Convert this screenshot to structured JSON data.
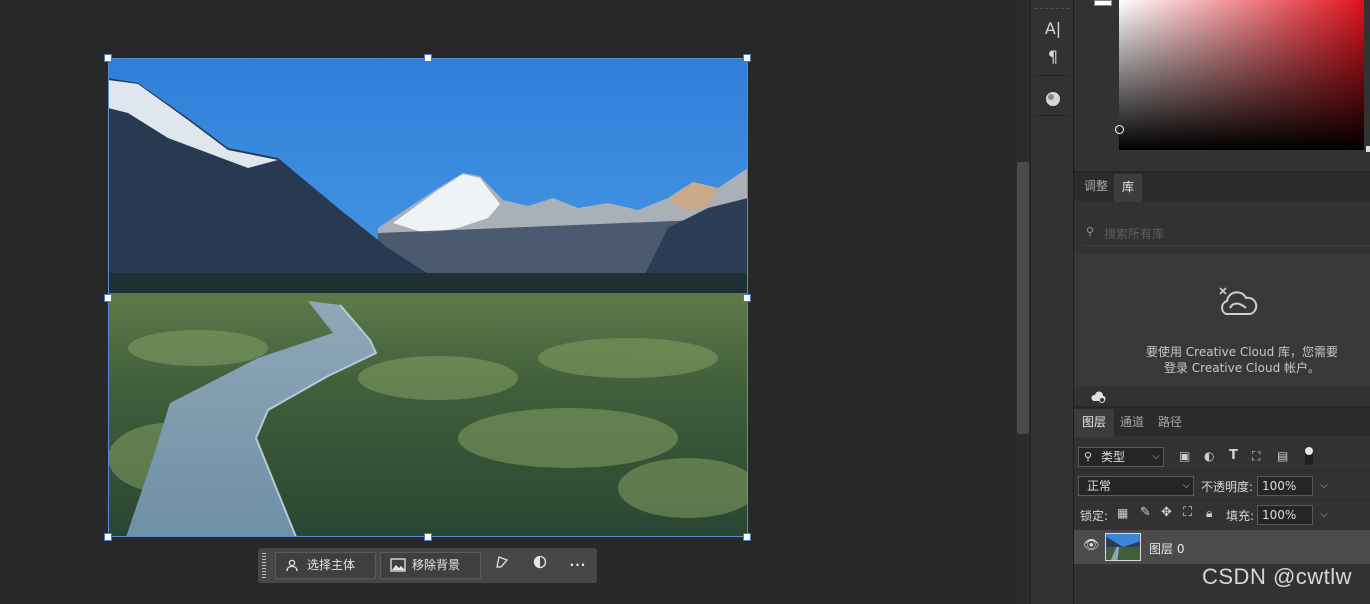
{
  "context_bar": {
    "select_subject_label": "选择主体",
    "remove_background_label": "移除背景"
  },
  "adjustments_tab": "调整",
  "libraries_tab": "库",
  "libraries_search_placeholder": "搜索所有库",
  "libraries_message": "要使用 Creative Cloud 库，您需要登录 Creative Cloud 帐户。",
  "layers_panel": {
    "tabs": [
      "图层",
      "通道",
      "路径"
    ],
    "filter_kind": "类型",
    "blend_mode": "正常",
    "opacity_label": "不透明度:",
    "opacity_value": "100%",
    "lock_label": "锁定:",
    "fill_label": "填充:",
    "fill_value": "100%",
    "layer_name": "图层 0"
  },
  "watermark": "CSDN @cwtlw",
  "colors": {
    "background": "#282828",
    "panel": "#323232",
    "selection": "#5a8bd6"
  }
}
